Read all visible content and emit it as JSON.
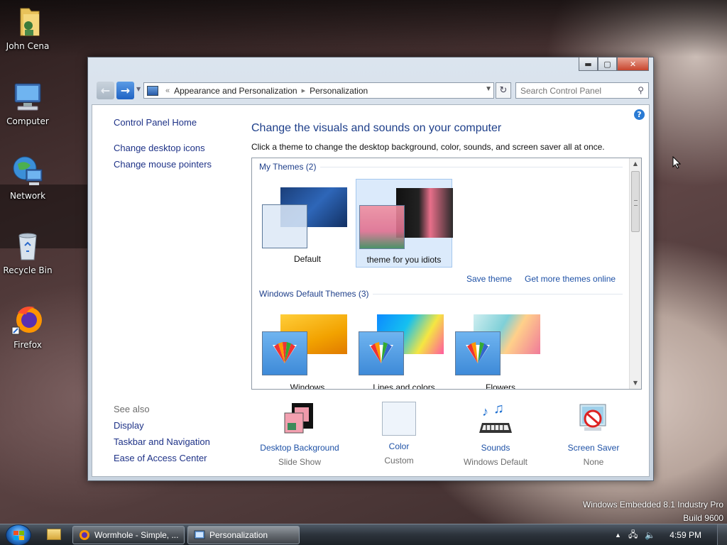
{
  "desktop": {
    "icons": [
      {
        "label": "John Cena",
        "icon": "user-folder-icon"
      },
      {
        "label": "Computer",
        "icon": "computer-icon"
      },
      {
        "label": "Network",
        "icon": "network-icon"
      },
      {
        "label": "Recycle Bin",
        "icon": "recycle-bin-icon"
      },
      {
        "label": "Firefox",
        "icon": "firefox-icon"
      }
    ],
    "watermark": {
      "line1": "Windows Embedded 8.1 Industry Pro",
      "line2": "Build 9600"
    }
  },
  "window": {
    "controls": {
      "minimize": "▬",
      "maximize": "▢",
      "close": "✕"
    },
    "breadcrumb": {
      "prefix": "«",
      "items": [
        "Appearance and Personalization",
        "Personalization"
      ]
    },
    "search_placeholder": "Search Control Panel",
    "help": "?",
    "left_pane": {
      "home": "Control Panel Home",
      "links": [
        "Change desktop icons",
        "Change mouse pointers"
      ],
      "see_also_title": "See also",
      "see_also": [
        "Display",
        "Taskbar and Navigation",
        "Ease of Access Center"
      ]
    },
    "heading": "Change the visuals and sounds on your computer",
    "subheading": "Click a theme to change the desktop background, color, sounds, and screen saver all at once.",
    "my_themes": {
      "title": "My Themes (2)",
      "items": [
        {
          "label": "Default",
          "selected": false
        },
        {
          "label": "theme for you idiots",
          "selected": true
        }
      ],
      "save_link": "Save theme",
      "get_more_link": "Get more themes online"
    },
    "default_themes": {
      "title": "Windows Default Themes (3)",
      "items": [
        {
          "label": "Windows"
        },
        {
          "label": "Lines and colors"
        },
        {
          "label": "Flowers"
        }
      ]
    },
    "bottom_settings": [
      {
        "label": "Desktop Background",
        "value": "Slide Show",
        "icon": "desktop-background-icon"
      },
      {
        "label": "Color",
        "value": "Custom",
        "icon": "color-swatch-icon"
      },
      {
        "label": "Sounds",
        "value": "Windows Default",
        "icon": "sounds-icon"
      },
      {
        "label": "Screen Saver",
        "value": "None",
        "icon": "screen-saver-icon"
      }
    ]
  },
  "taskbar": {
    "buttons": [
      {
        "label": "Wormhole - Simple, ...",
        "active": false
      },
      {
        "label": "Personalization",
        "active": true
      }
    ],
    "clock": "4:59 PM",
    "tray_up": "▲"
  }
}
